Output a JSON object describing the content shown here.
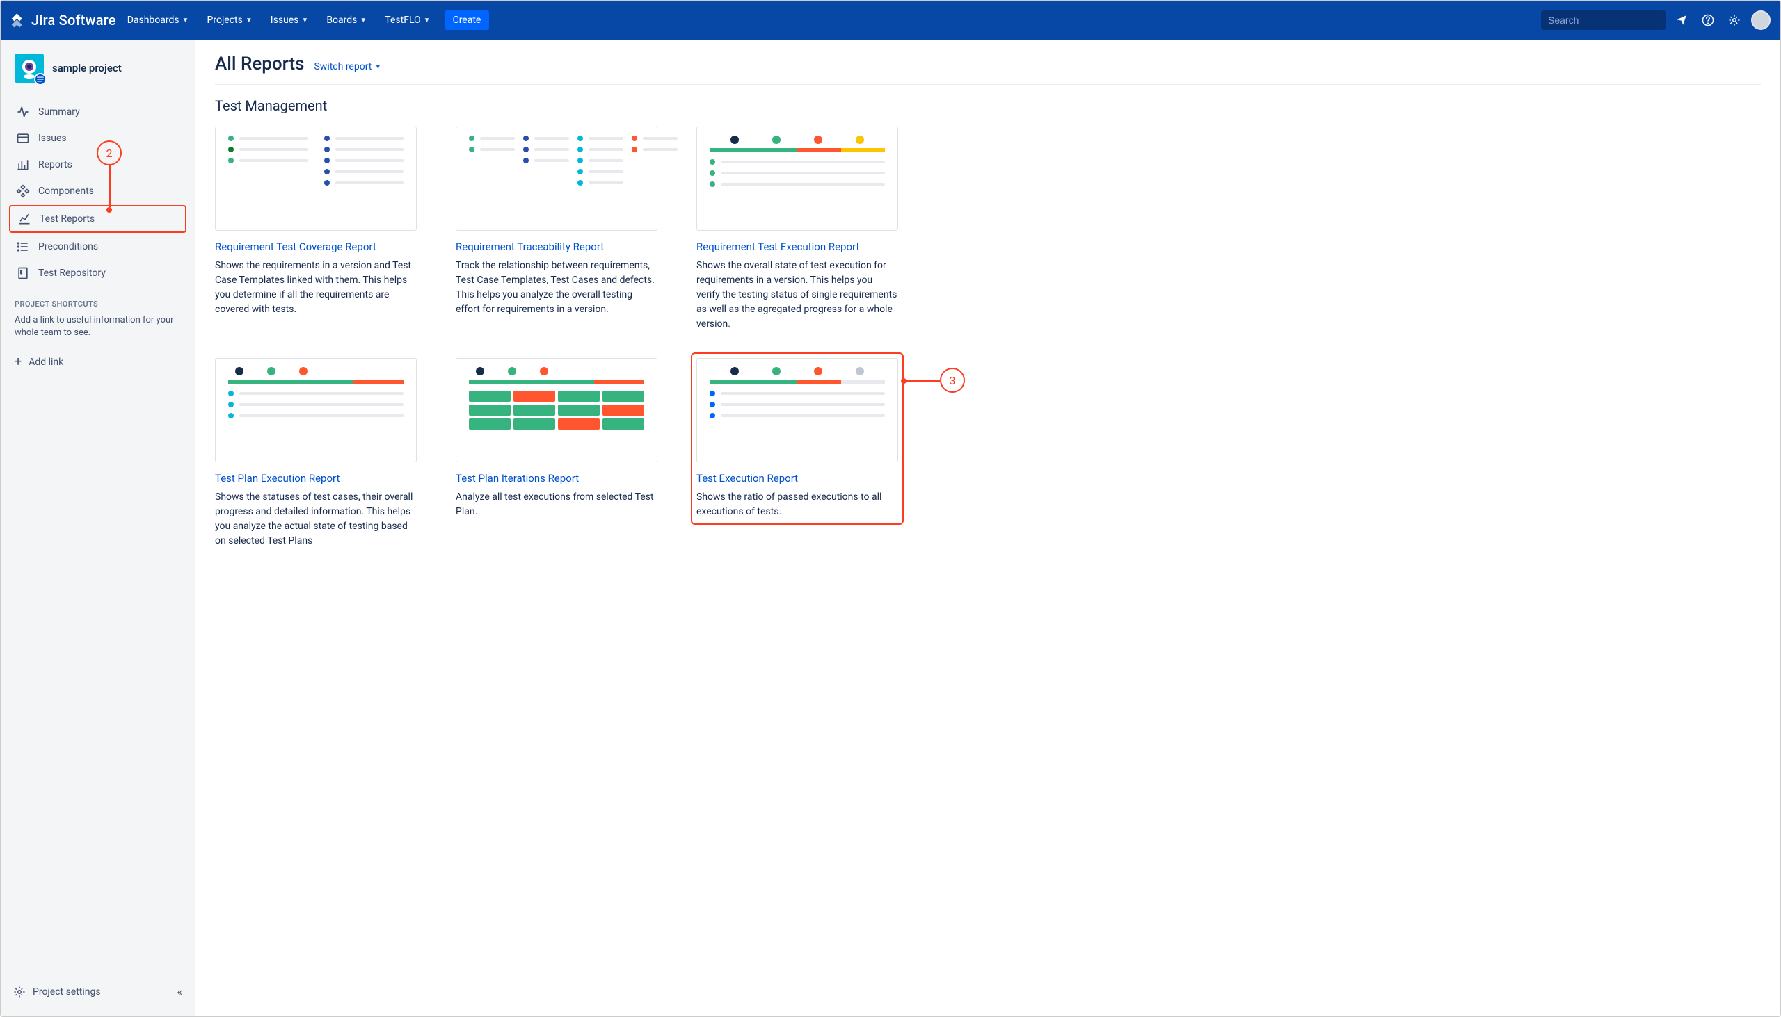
{
  "topbar": {
    "brand": "Jira Software",
    "nav": [
      {
        "label": "Dashboards"
      },
      {
        "label": "Projects"
      },
      {
        "label": "Issues"
      },
      {
        "label": "Boards"
      },
      {
        "label": "TestFLO"
      }
    ],
    "create": "Create",
    "search_placeholder": "Search"
  },
  "sidebar": {
    "project_name": "sample project",
    "items": [
      {
        "label": "Summary"
      },
      {
        "label": "Issues"
      },
      {
        "label": "Reports"
      },
      {
        "label": "Components"
      },
      {
        "label": "Test Reports"
      },
      {
        "label": "Preconditions"
      },
      {
        "label": "Test Repository"
      }
    ],
    "shortcuts_title": "PROJECT SHORTCUTS",
    "shortcuts_text": "Add a link to useful information for your whole team to see.",
    "add_link": "Add link",
    "settings": "Project settings"
  },
  "main": {
    "title": "All Reports",
    "switch": "Switch report",
    "section": "Test Management",
    "cards": [
      {
        "title": "Requirement Test Coverage Report",
        "desc": "Shows the requirements in a version and Test Case Templates linked with them. This helps you determine if all the requirements are covered with tests."
      },
      {
        "title": "Requirement Traceability Report",
        "desc": "Track the relationship between requirements, Test Case Templates, Test Cases and defects. This helps you analyze the overall testing effort for requirements in a version."
      },
      {
        "title": "Requirement Test Execution Report",
        "desc": "Shows the overall state of test execution for requirements in a version. This helps you verify the testing status of single requirements as well as the agregated progress for a whole version."
      },
      {
        "title": "Test Plan Execution Report",
        "desc": "Shows the statuses of test cases, their overall progress and detailed information. This helps you analyze the actual state of testing based on selected Test Plans"
      },
      {
        "title": "Test Plan Iterations Report",
        "desc": "Analyze all test executions from selected Test Plan."
      },
      {
        "title": "Test Execution Report",
        "desc": "Shows the ratio of passed executions to all executions of tests."
      }
    ]
  },
  "annotations": {
    "a2": "2",
    "a3": "3"
  }
}
